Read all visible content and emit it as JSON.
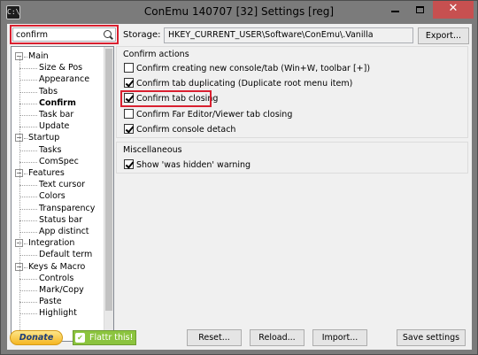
{
  "window": {
    "title": "ConEmu 140707 [32] Settings [reg]",
    "app_icon_text": "C:\\",
    "minimize_label": "",
    "maximize_label": "",
    "close_label": "✕"
  },
  "search": {
    "value": "confirm",
    "placeholder": ""
  },
  "tree": {
    "items": [
      {
        "label": "Main",
        "level": 0,
        "expanded": true
      },
      {
        "label": "Size & Pos",
        "level": 1
      },
      {
        "label": "Appearance",
        "level": 1
      },
      {
        "label": "Tabs",
        "level": 1
      },
      {
        "label": "Confirm",
        "level": 1,
        "selected": true
      },
      {
        "label": "Task bar",
        "level": 1
      },
      {
        "label": "Update",
        "level": 1
      },
      {
        "label": "Startup",
        "level": 0,
        "expanded": true
      },
      {
        "label": "Tasks",
        "level": 1
      },
      {
        "label": "ComSpec",
        "level": 1
      },
      {
        "label": "Features",
        "level": 0,
        "expanded": true
      },
      {
        "label": "Text cursor",
        "level": 1
      },
      {
        "label": "Colors",
        "level": 1
      },
      {
        "label": "Transparency",
        "level": 1
      },
      {
        "label": "Status bar",
        "level": 1
      },
      {
        "label": "App distinct",
        "level": 1
      },
      {
        "label": "Integration",
        "level": 0,
        "expanded": true
      },
      {
        "label": "Default term",
        "level": 1
      },
      {
        "label": "Keys & Macro",
        "level": 0,
        "expanded": true
      },
      {
        "label": "Controls",
        "level": 1
      },
      {
        "label": "Mark/Copy",
        "level": 1
      },
      {
        "label": "Paste",
        "level": 1
      },
      {
        "label": "Highlight",
        "level": 1
      }
    ]
  },
  "storage": {
    "label": "Storage:",
    "value": "HKEY_CURRENT_USER\\Software\\ConEmu\\.Vanilla",
    "export_label": "Export..."
  },
  "confirm_actions": {
    "title": "Confirm actions",
    "options": [
      {
        "label": "Confirm creating new console/tab (Win+W, toolbar [+])",
        "checked": false
      },
      {
        "label": "Confirm tab duplicating (Duplicate root menu item)",
        "checked": true
      },
      {
        "label": "Confirm tab closing",
        "checked": true,
        "highlighted": true
      },
      {
        "label": "Confirm Far Editor/Viewer tab closing",
        "checked": false
      },
      {
        "label": "Confirm console detach",
        "checked": true
      }
    ]
  },
  "misc": {
    "title": "Miscellaneous",
    "options": [
      {
        "label": "Show 'was hidden' warning",
        "checked": true
      }
    ]
  },
  "footer": {
    "donate_label": "Donate",
    "flattr_label": "Flattr this!",
    "reset_label": "Reset...",
    "reload_label": "Reload...",
    "import_label": "Import...",
    "save_label": "Save settings"
  },
  "colors": {
    "accent_red": "#d92030",
    "titlebar": "#7b7b7b",
    "close_button": "#c75050",
    "flattr_green": "#8cc43f",
    "donate_gold": "#f5b622"
  }
}
